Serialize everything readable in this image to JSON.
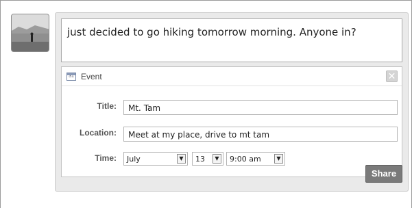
{
  "status": {
    "text": "just decided to go hiking tomorrow morning. Anyone in?"
  },
  "event": {
    "header": "Event",
    "icon_text": "31",
    "close_glyph": "✕",
    "title_label": "Title:",
    "title_value": "Mt. Tam",
    "location_label": "Location:",
    "location_value": "Meet at my place, drive to mt tam",
    "time_label": "Time:",
    "month": "July",
    "day": "13",
    "time": "9:00 am"
  },
  "actions": {
    "share_label": "Share"
  },
  "icons": {
    "avatar": "profile-photo",
    "calendar": "calendar-icon",
    "close": "close-icon",
    "dropdown": "chevron-down-icon"
  }
}
